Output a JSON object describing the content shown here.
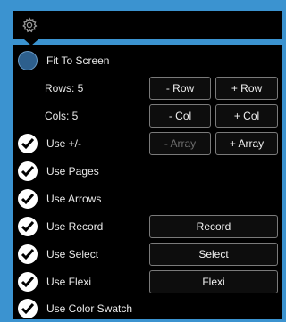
{
  "header": {
    "icon": "gear-icon"
  },
  "options": {
    "fit_to_screen": {
      "label": "Fit To Screen",
      "checked": false
    },
    "rows_label": "Rows: 5",
    "cols_label": "Cols: 5",
    "use_plus_minus": {
      "label": "Use +/-",
      "checked": true
    },
    "use_pages": {
      "label": "Use Pages",
      "checked": true
    },
    "use_arrows": {
      "label": "Use Arrows",
      "checked": true
    },
    "use_record": {
      "label": "Use Record",
      "checked": true
    },
    "use_select": {
      "label": "Use Select",
      "checked": true
    },
    "use_flexi": {
      "label": "Use Flexi",
      "checked": true
    },
    "use_color_swatch": {
      "label": "Use Color Swatch",
      "checked": true
    }
  },
  "buttons": {
    "minus_row": "- Row",
    "plus_row": "+ Row",
    "minus_col": "- Col",
    "plus_col": "+ Col",
    "minus_array": "- Array",
    "plus_array": "+ Array",
    "record": "Record",
    "select": "Select",
    "flexi": "Flexi"
  },
  "colors": {
    "background": "#3b93d0",
    "panel": "#000000",
    "button_border": "#7a7a7a",
    "disabled_text": "#6d6d6d"
  }
}
